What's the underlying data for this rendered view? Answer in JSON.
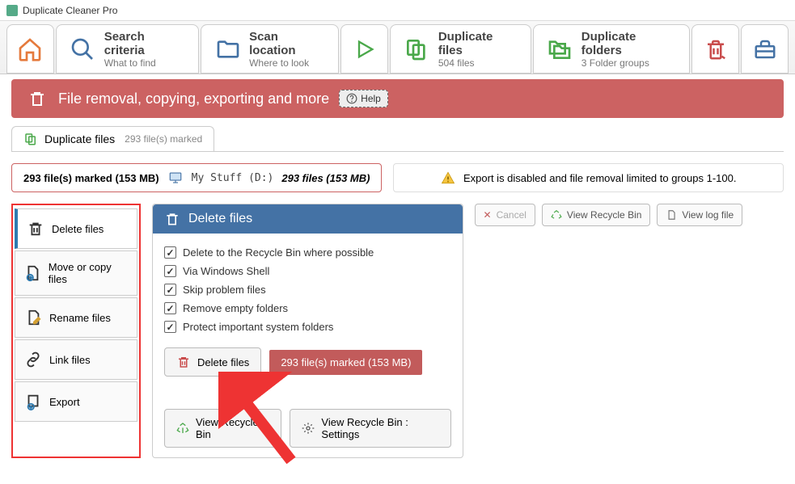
{
  "window_title": "Duplicate Cleaner Pro",
  "tabs": [
    {
      "title": "",
      "sub": ""
    },
    {
      "title": "Search criteria",
      "sub": "What to find"
    },
    {
      "title": "Scan location",
      "sub": "Where to look"
    },
    {
      "title": "",
      "sub": ""
    },
    {
      "title": "Duplicate files",
      "sub": "504 files"
    },
    {
      "title": "Duplicate folders",
      "sub": "3 Folder groups"
    },
    {
      "title": "",
      "sub": ""
    },
    {
      "title": "",
      "sub": ""
    }
  ],
  "section_title": "File removal, copying, exporting and more",
  "help_label": "Help",
  "sub_tab_title": "Duplicate files",
  "sub_tab_count": "293 file(s) marked",
  "marked_info": "293 file(s) marked (153 MB)",
  "drive_label": "My Stuff (D:)",
  "drive_files": "293 files (153 MB)",
  "warning_text": "Export is disabled and file removal limited to groups 1-100.",
  "side_tabs": [
    "Delete files",
    "Move or copy files",
    "Rename files",
    "Link files",
    "Export"
  ],
  "panel_title": "Delete files",
  "options": [
    "Delete to the Recycle Bin where possible",
    "Via Windows Shell",
    "Skip problem files",
    "Remove empty folders",
    "Protect important system folders"
  ],
  "delete_btn": "Delete files",
  "delete_badge": "293 file(s) marked (153 MB)",
  "view_rb": "View Recycle Bin",
  "view_rb_settings": "View Recycle Bin : Settings",
  "cancel": "Cancel",
  "view_recycle": "View Recycle Bin",
  "view_log": "View log file"
}
